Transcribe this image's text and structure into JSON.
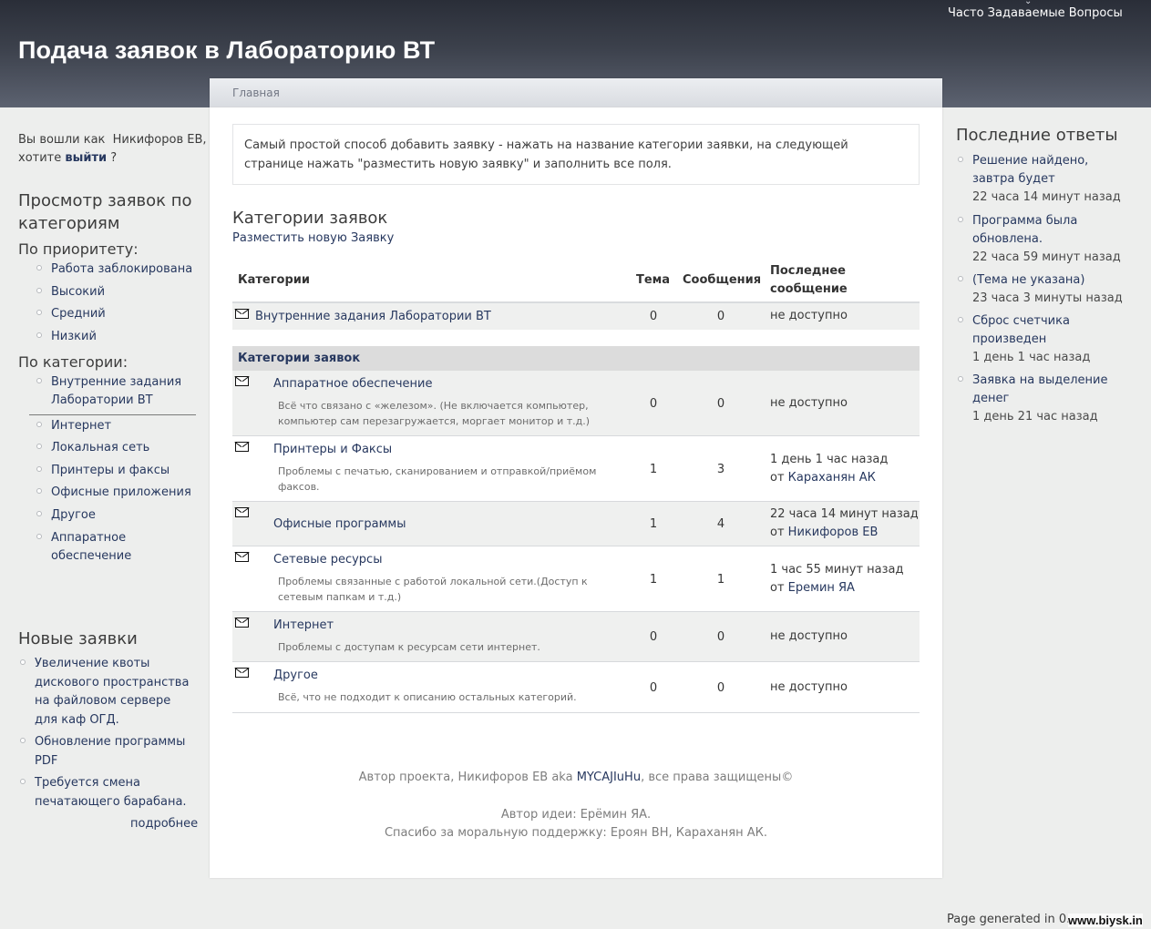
{
  "header": {
    "title": "Подача заявок в Лабораторию ВТ",
    "faq_link": "Часто Задаваемые Вопросы"
  },
  "breadcrumb": {
    "home": "Главная"
  },
  "user": {
    "prefix": "Вы вошли как",
    "name": "Никифоров ЕВ,",
    "question": "хотите",
    "logout": "выйти",
    "suffix": "?"
  },
  "left_sidebar": {
    "browse_title": "Просмотр заявок по категориям",
    "by_priority_label": "По приоритету:",
    "priorities": [
      "Работа заблокирована",
      "Высокий",
      "Средний",
      "Низкий"
    ],
    "by_category_label": "По категории:",
    "categories": [
      "Внутренние задания Лаборатории ВТ",
      "Интернет",
      "Локальная сеть",
      "Принтеры и факсы",
      "Офисные приложения",
      "Другое",
      "Аппаратное обеспечение"
    ],
    "new_title": "Новые заявки",
    "new_items": [
      "Увеличение квоты дискового пространства на файловом сервере для каф ОГД.",
      "Обновление программы PDF",
      "Требуется смена печатающего барабана."
    ],
    "more_label": "подробнее"
  },
  "main": {
    "intro": "Самый простой способ добавить заявку - нажать на название категории заявки, на следующей странице нажать \"разместить новую заявку\" и заполнить все поля.",
    "heading": "Категории заявок",
    "post_new": "Разместить новую Заявку",
    "columns": {
      "category": "Категории",
      "topics": "Тема",
      "posts": "Сообщения",
      "last_line1": "Последнее",
      "last_line2": "сообщение"
    },
    "top_row": {
      "name": "Внутренние задания Лаборатории ВТ",
      "topics": "0",
      "posts": "0",
      "last": "не доступно"
    },
    "section_title": "Категории заявок",
    "rows": [
      {
        "name": "Аппаратное обеспечение",
        "desc": "Всё что связано с «железом». (Не включается компьютер, компьютер сам перезагружается, моргает монитор и т.д.)",
        "topics": "0",
        "posts": "0",
        "last_line1": "не доступно",
        "last_by": "",
        "last_author": ""
      },
      {
        "name": "Принтеры и Факсы",
        "desc": "Проблемы с печатью, сканированием и отправкой/приёмом факсов.",
        "topics": "1",
        "posts": "3",
        "last_line1": "1 день 1 час назад",
        "last_by": "от",
        "last_author": "Караханян АК"
      },
      {
        "name": "Офисные программы",
        "desc": "",
        "topics": "1",
        "posts": "4",
        "last_line1": "22 часа 14 минут назад",
        "last_by": "от",
        "last_author": "Никифоров ЕВ"
      },
      {
        "name": "Сетевые ресурсы",
        "desc": "Проблемы связанные с работой локальной сети.(Доступ к сетевым папкам и т.д.)",
        "topics": "1",
        "posts": "1",
        "last_line1": "1 час 55 минут назад",
        "last_by": "от",
        "last_author": "Еремин ЯА"
      },
      {
        "name": "Интернет",
        "desc": "Проблемы с доступам к ресурсам сети интернет.",
        "topics": "0",
        "posts": "0",
        "last_line1": "не доступно",
        "last_by": "",
        "last_author": ""
      },
      {
        "name": "Другое",
        "desc": "Всё, что не подходит к описанию остальных категорий.",
        "topics": "0",
        "posts": "0",
        "last_line1": "не доступно",
        "last_by": "",
        "last_author": ""
      }
    ],
    "footer": {
      "author_prefix": "Автор проекта, Никифоров ЕВ aka",
      "author_nick": "MYCAJIuHu",
      "author_suffix": ", все права защищены©",
      "idea": "Автор идеи: Ерёмин ЯА.",
      "thanks": "Спасибо за моральную поддержку: Ероян ВН, Караханян АК."
    }
  },
  "right_sidebar": {
    "title": "Последние ответы",
    "items": [
      {
        "title": "Решение найдено, завтра будет",
        "when": "22 часа 14 минут назад"
      },
      {
        "title": "Программа была обновлена.",
        "when": "22 часа 59 минут назад"
      },
      {
        "title": "(Тема не указана)",
        "when": "23 часа 3 минуты назад"
      },
      {
        "title": " Сброс счетчика произведен",
        "when": "1 день 1 час назад"
      },
      {
        "title": "Заявка на выделение денег",
        "when": "1 день 21 час назад"
      }
    ]
  },
  "page_generated": "Page generated in 0.",
  "watermark": "www.biysk.in"
}
